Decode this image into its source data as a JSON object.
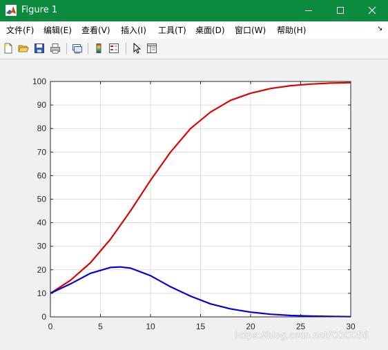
{
  "window": {
    "title": "Figure 1",
    "accent": "#0c8a3e"
  },
  "menu": [
    {
      "label": "文件(F)"
    },
    {
      "label": "编辑(E)"
    },
    {
      "label": "查看(V)"
    },
    {
      "label": "插入(I)"
    },
    {
      "label": "工具(T)"
    },
    {
      "label": "桌面(D)"
    },
    {
      "label": "窗口(W)"
    },
    {
      "label": "帮助(H)"
    }
  ],
  "toolbar": [
    {
      "icon": "new-figure-icon"
    },
    {
      "icon": "open-file-icon"
    },
    {
      "icon": "save-icon"
    },
    {
      "icon": "print-icon"
    },
    {
      "icon": "link-plot-icon"
    },
    {
      "icon": "insert-colorbar-icon"
    },
    {
      "icon": "insert-legend-icon"
    },
    {
      "icon": "edit-plot-pointer-icon"
    },
    {
      "icon": "property-editor-icon"
    }
  ],
  "chart_data": {
    "type": "line",
    "title": "",
    "xlabel": "",
    "ylabel": "",
    "xlim": [
      0,
      30
    ],
    "ylim": [
      0,
      100
    ],
    "xticks": [
      0,
      5,
      10,
      15,
      20,
      25,
      30
    ],
    "yticks": [
      0,
      10,
      20,
      30,
      40,
      50,
      60,
      70,
      80,
      90,
      100
    ],
    "grid": true,
    "series": [
      {
        "color": "#e00000",
        "x": [
          0,
          2,
          4,
          6,
          8,
          10,
          12,
          14,
          16,
          18,
          20,
          22,
          24,
          26,
          28,
          30
        ],
        "y": [
          10,
          15.5,
          23,
          33,
          45,
          58,
          70,
          80,
          87,
          92,
          95,
          97,
          98.2,
          98.9,
          99.3,
          99.5
        ]
      },
      {
        "color": "#0000e0",
        "x": [
          0,
          2,
          4,
          6,
          7,
          8,
          10,
          12,
          14,
          16,
          18,
          20,
          22,
          24,
          26,
          28,
          30
        ],
        "y": [
          10,
          14,
          18.5,
          21,
          21.2,
          20.7,
          17.5,
          12.8,
          8.8,
          5.5,
          3.4,
          2.0,
          1.1,
          0.6,
          0.35,
          0.2,
          0.1
        ]
      }
    ]
  },
  "watermark": "https://blog.csdn.net/COCO56"
}
